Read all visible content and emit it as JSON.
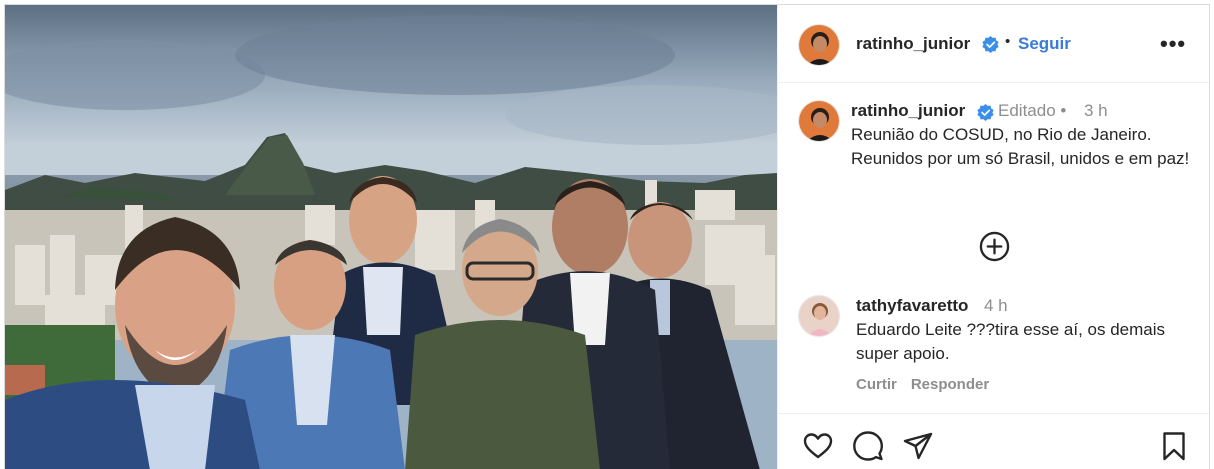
{
  "post": {
    "username": "ratinho_junior",
    "follow_label": "Seguir",
    "separator": "•",
    "more_label": "•••",
    "photo_alt_icon": "group-selfie-photo"
  },
  "caption": {
    "username": "ratinho_junior",
    "edited_label": "Editado •",
    "time": "3 h",
    "text": "Reunião do COSUD, no Rio de Janeiro. Reunidos por um só Brasil, unidos e em paz!"
  },
  "comment": {
    "username": "tathyfavaretto",
    "time": "4 h",
    "text": "Eduardo Leite ???tira esse aí, os demais super apoio.",
    "like_label": "Curtir",
    "reply_label": "Responder"
  },
  "icons": {
    "verified": "verified-badge-icon",
    "load_more": "plus-circle-icon",
    "like": "heart-icon",
    "comment": "comment-bubble-icon",
    "share": "send-icon",
    "save": "bookmark-icon"
  },
  "colors": {
    "accent": "#3b7bd7",
    "verified": "#3b8fe8",
    "muted": "#8e8e8e",
    "text": "#262626"
  }
}
